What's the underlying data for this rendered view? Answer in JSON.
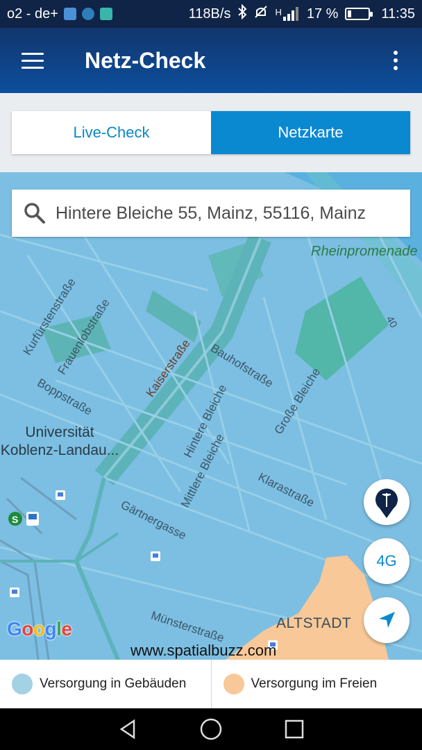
{
  "status_bar": {
    "carrier": "o2 - de+",
    "net_speed": "118B/s",
    "network_type": "H",
    "battery_percent": "17 %",
    "battery_level": 0.17,
    "time": "11:35",
    "icons": [
      "picture-icon",
      "cloud-icon",
      "mail-icon",
      "bluetooth-icon",
      "mute-icon",
      "signal-icon",
      "battery-icon"
    ]
  },
  "app_bar": {
    "title": "Netz-Check"
  },
  "tabs": [
    {
      "label": "Live-Check",
      "selected": false
    },
    {
      "label": "Netzkarte",
      "selected": true
    }
  ],
  "search": {
    "value": "Hintere Bleiche 55, Mainz, 55116, Mainz"
  },
  "map": {
    "labels": {
      "rheinpromenade": "Rheinpromenade",
      "university": "Universität\nKoblenz-Landau...",
      "altstadt": "ALTSTADT",
      "route_40": "40"
    },
    "streets": {
      "kurfuerstenstrasse": "Kurfürstenstraße",
      "frauenlobstrasse": "Frauenlobstraße",
      "boppstrasse": "Boppstraße",
      "kaiserstrasse": "Kaiserstraße",
      "bauhofstrasse": "Bauhofstraße",
      "hintere_bleiche": "Hintere Bleiche",
      "grosse_bleiche": "Große Bleiche",
      "mittlere_bleiche": "Mittlere Bleiche",
      "klarastrasse": "Klarastraße",
      "gaertnergasse": "Gärtnergasse",
      "muensterstrasse": "Münsterstraße"
    },
    "google_logo": "Google",
    "watermark": "www.spatialbuzz.com",
    "fab_network": "4G",
    "colors": {
      "indoor": "#a3d2e4",
      "outdoor": "#f8c898",
      "coverage_fill": "#7cbfe3",
      "accent": "#0a89d1"
    }
  },
  "legend": [
    {
      "label": "Versorgung in Gebäuden",
      "color": "#a3d2e4"
    },
    {
      "label": "Versorgung im Freien",
      "color": "#f8c898"
    }
  ]
}
